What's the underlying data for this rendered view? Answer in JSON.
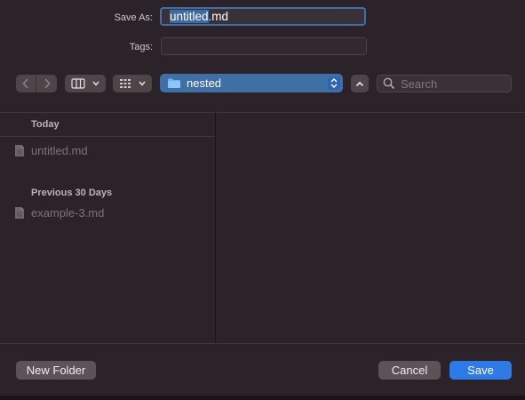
{
  "save_as": {
    "label": "Save As:",
    "value_selected": "untitled",
    "value_rest": ".md"
  },
  "tags": {
    "label": "Tags:",
    "value": ""
  },
  "toolbar": {
    "back_icon": "chevron-left-icon",
    "forward_icon": "chevron-right-icon",
    "view_icon": "column-view-icon",
    "group_icon": "grid-icon",
    "location": "nested",
    "expand_icon": "chevron-up-icon",
    "search_placeholder": "Search"
  },
  "sidebar": {
    "sections": [
      {
        "header": "Today",
        "items": [
          {
            "name": "untitled.md",
            "icon": "document-icon"
          }
        ]
      },
      {
        "header": "Previous 30 Days",
        "items": [
          {
            "name": "example-3.md",
            "icon": "document-icon"
          }
        ]
      }
    ]
  },
  "footer": {
    "new_folder_label": "New Folder",
    "cancel_label": "Cancel",
    "save_label": "Save"
  },
  "colors": {
    "background": "#2c2229",
    "accent": "#2e7be8",
    "focus_ring": "#3f6fa4"
  }
}
